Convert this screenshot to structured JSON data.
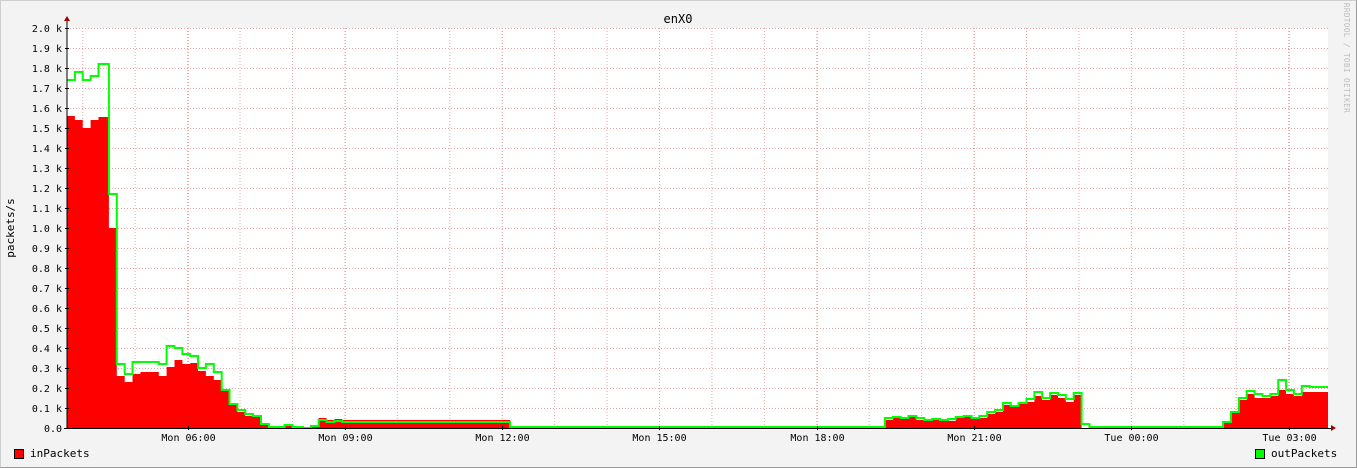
{
  "chart_data": {
    "type": "area",
    "title": "enX0",
    "ylabel": "packets/s",
    "ylim": [
      0,
      2000
    ],
    "y_ticks": [
      {
        "value": 0,
        "label": "0.0"
      },
      {
        "value": 100,
        "label": "0.1 k"
      },
      {
        "value": 200,
        "label": "0.2 k"
      },
      {
        "value": 300,
        "label": "0.3 k"
      },
      {
        "value": 400,
        "label": "0.4 k"
      },
      {
        "value": 500,
        "label": "0.5 k"
      },
      {
        "value": 600,
        "label": "0.6 k"
      },
      {
        "value": 700,
        "label": "0.7 k"
      },
      {
        "value": 800,
        "label": "0.8 k"
      },
      {
        "value": 900,
        "label": "0.9 k"
      },
      {
        "value": 1000,
        "label": "1.0 k"
      },
      {
        "value": 1100,
        "label": "1.1 k"
      },
      {
        "value": 1200,
        "label": "1.2 k"
      },
      {
        "value": 1300,
        "label": "1.3 k"
      },
      {
        "value": 1400,
        "label": "1.4 k"
      },
      {
        "value": 1500,
        "label": "1.5 k"
      },
      {
        "value": 1600,
        "label": "1.6 k"
      },
      {
        "value": 1700,
        "label": "1.7 k"
      },
      {
        "value": 1800,
        "label": "1.8 k"
      },
      {
        "value": 1900,
        "label": "1.9 k"
      },
      {
        "value": 2000,
        "label": "2.0 k"
      }
    ],
    "x_range_hours": [
      3.7,
      27.75
    ],
    "x_ticks": [
      {
        "hour": 6,
        "label": "Mon 06:00"
      },
      {
        "hour": 9,
        "label": "Mon 09:00"
      },
      {
        "hour": 12,
        "label": "Mon 12:00"
      },
      {
        "hour": 15,
        "label": "Mon 15:00"
      },
      {
        "hour": 18,
        "label": "Mon 18:00"
      },
      {
        "hour": 21,
        "label": "Mon 21:00"
      },
      {
        "hour": 24,
        "label": "Tue 00:00"
      },
      {
        "hour": 27,
        "label": "Tue 03:00"
      }
    ],
    "minor_x_interval_hours": 1,
    "grid": true,
    "legend_placement": "bottom",
    "series": [
      {
        "name": "inPackets",
        "color": "#ff0000",
        "style": "area",
        "points": [
          [
            3.7,
            1560
          ],
          [
            3.85,
            1540
          ],
          [
            4.0,
            1500
          ],
          [
            4.15,
            1540
          ],
          [
            4.3,
            1555
          ],
          [
            4.5,
            1000
          ],
          [
            4.65,
            260
          ],
          [
            4.8,
            230
          ],
          [
            4.95,
            270
          ],
          [
            5.1,
            280
          ],
          [
            5.3,
            280
          ],
          [
            5.45,
            260
          ],
          [
            5.6,
            305
          ],
          [
            5.75,
            340
          ],
          [
            5.9,
            320
          ],
          [
            6.05,
            325
          ],
          [
            6.2,
            285
          ],
          [
            6.35,
            260
          ],
          [
            6.5,
            240
          ],
          [
            6.65,
            185
          ],
          [
            6.8,
            115
          ],
          [
            6.95,
            80
          ],
          [
            7.1,
            60
          ],
          [
            7.25,
            55
          ],
          [
            7.4,
            15
          ],
          [
            7.55,
            0
          ],
          [
            7.85,
            10
          ],
          [
            8.0,
            0
          ],
          [
            8.2,
            0
          ],
          [
            8.35,
            5
          ],
          [
            8.5,
            50
          ],
          [
            8.65,
            40
          ],
          [
            8.8,
            45
          ],
          [
            8.95,
            40
          ],
          [
            12.15,
            0
          ],
          [
            19.3,
            40
          ],
          [
            19.45,
            50
          ],
          [
            19.6,
            50
          ],
          [
            19.75,
            55
          ],
          [
            19.9,
            40
          ],
          [
            20.05,
            35
          ],
          [
            20.2,
            40
          ],
          [
            20.35,
            38
          ],
          [
            20.5,
            35
          ],
          [
            20.65,
            50
          ],
          [
            20.8,
            55
          ],
          [
            20.95,
            45
          ],
          [
            21.1,
            50
          ],
          [
            21.25,
            70
          ],
          [
            21.4,
            80
          ],
          [
            21.55,
            115
          ],
          [
            21.7,
            105
          ],
          [
            21.85,
            120
          ],
          [
            22.0,
            130
          ],
          [
            22.15,
            160
          ],
          [
            22.3,
            140
          ],
          [
            22.45,
            165
          ],
          [
            22.6,
            150
          ],
          [
            22.75,
            130
          ],
          [
            22.9,
            165
          ],
          [
            23.05,
            0
          ],
          [
            25.6,
            0
          ],
          [
            25.75,
            30
          ],
          [
            25.9,
            80
          ],
          [
            26.05,
            140
          ],
          [
            26.2,
            170
          ],
          [
            26.35,
            150
          ],
          [
            26.5,
            150
          ],
          [
            26.65,
            160
          ],
          [
            26.8,
            190
          ],
          [
            26.95,
            170
          ],
          [
            27.1,
            160
          ],
          [
            27.25,
            180
          ],
          [
            27.4,
            180
          ]
        ]
      },
      {
        "name": "outPackets",
        "color": "#00ff00",
        "style": "line",
        "points": [
          [
            3.7,
            1740
          ],
          [
            3.85,
            1780
          ],
          [
            4.0,
            1740
          ],
          [
            4.15,
            1760
          ],
          [
            4.3,
            1820
          ],
          [
            4.5,
            1170
          ],
          [
            4.65,
            320
          ],
          [
            4.8,
            270
          ],
          [
            4.95,
            330
          ],
          [
            5.1,
            330
          ],
          [
            5.3,
            330
          ],
          [
            5.45,
            320
          ],
          [
            5.6,
            410
          ],
          [
            5.75,
            400
          ],
          [
            5.9,
            370
          ],
          [
            6.05,
            360
          ],
          [
            6.2,
            300
          ],
          [
            6.35,
            320
          ],
          [
            6.5,
            280
          ],
          [
            6.65,
            190
          ],
          [
            6.8,
            120
          ],
          [
            6.95,
            90
          ],
          [
            7.1,
            70
          ],
          [
            7.25,
            60
          ],
          [
            7.4,
            20
          ],
          [
            7.55,
            5
          ],
          [
            7.85,
            15
          ],
          [
            8.0,
            5
          ],
          [
            8.2,
            0
          ],
          [
            8.35,
            10
          ],
          [
            8.5,
            40
          ],
          [
            8.65,
            30
          ],
          [
            8.8,
            35
          ],
          [
            8.95,
            30
          ],
          [
            12.15,
            5
          ],
          [
            19.3,
            50
          ],
          [
            19.45,
            55
          ],
          [
            19.6,
            50
          ],
          [
            19.75,
            60
          ],
          [
            19.9,
            50
          ],
          [
            20.05,
            40
          ],
          [
            20.2,
            45
          ],
          [
            20.35,
            40
          ],
          [
            20.5,
            45
          ],
          [
            20.65,
            55
          ],
          [
            20.8,
            60
          ],
          [
            20.95,
            50
          ],
          [
            21.1,
            60
          ],
          [
            21.25,
            80
          ],
          [
            21.4,
            90
          ],
          [
            21.55,
            125
          ],
          [
            21.7,
            110
          ],
          [
            21.85,
            125
          ],
          [
            22.0,
            145
          ],
          [
            22.15,
            180
          ],
          [
            22.3,
            150
          ],
          [
            22.45,
            175
          ],
          [
            22.6,
            165
          ],
          [
            22.75,
            145
          ],
          [
            22.9,
            175
          ],
          [
            23.05,
            20
          ],
          [
            23.2,
            5
          ],
          [
            25.6,
            5
          ],
          [
            25.75,
            30
          ],
          [
            25.9,
            80
          ],
          [
            26.05,
            150
          ],
          [
            26.2,
            185
          ],
          [
            26.35,
            170
          ],
          [
            26.5,
            160
          ],
          [
            26.65,
            170
          ],
          [
            26.8,
            240
          ],
          [
            26.95,
            190
          ],
          [
            27.1,
            170
          ],
          [
            27.25,
            210
          ],
          [
            27.4,
            205
          ]
        ]
      }
    ],
    "credit": "RRDTOOL / TOBI OETIKER"
  }
}
